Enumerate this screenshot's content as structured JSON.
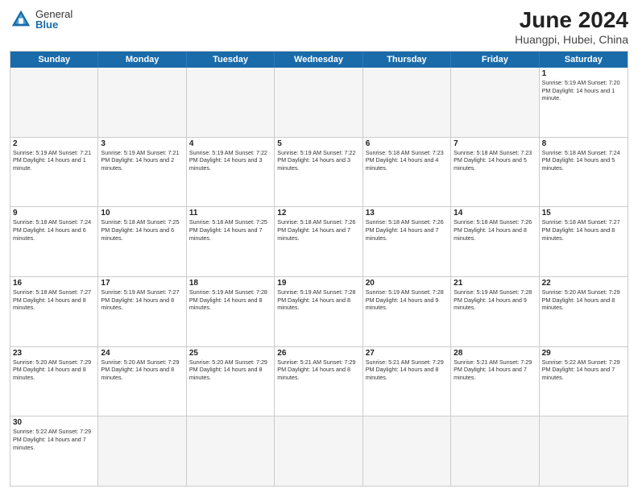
{
  "header": {
    "logo_general": "General",
    "logo_blue": "Blue",
    "title": "June 2024",
    "location": "Huangpi, Hubei, China"
  },
  "weekdays": [
    "Sunday",
    "Monday",
    "Tuesday",
    "Wednesday",
    "Thursday",
    "Friday",
    "Saturday"
  ],
  "rows": [
    [
      {
        "day": "",
        "content": "",
        "empty": true
      },
      {
        "day": "",
        "content": "",
        "empty": true
      },
      {
        "day": "",
        "content": "",
        "empty": true
      },
      {
        "day": "",
        "content": "",
        "empty": true
      },
      {
        "day": "",
        "content": "",
        "empty": true
      },
      {
        "day": "",
        "content": "",
        "empty": true
      },
      {
        "day": "1",
        "content": "Sunrise: 5:19 AM\nSunset: 7:20 PM\nDaylight: 14 hours\nand 1 minute.",
        "empty": false
      }
    ],
    [
      {
        "day": "2",
        "content": "Sunrise: 5:19 AM\nSunset: 7:21 PM\nDaylight: 14 hours\nand 1 minute.",
        "empty": false
      },
      {
        "day": "3",
        "content": "Sunrise: 5:19 AM\nSunset: 7:21 PM\nDaylight: 14 hours\nand 2 minutes.",
        "empty": false
      },
      {
        "day": "4",
        "content": "Sunrise: 5:19 AM\nSunset: 7:22 PM\nDaylight: 14 hours\nand 3 minutes.",
        "empty": false
      },
      {
        "day": "5",
        "content": "Sunrise: 5:19 AM\nSunset: 7:22 PM\nDaylight: 14 hours\nand 3 minutes.",
        "empty": false
      },
      {
        "day": "6",
        "content": "Sunrise: 5:18 AM\nSunset: 7:23 PM\nDaylight: 14 hours\nand 4 minutes.",
        "empty": false
      },
      {
        "day": "7",
        "content": "Sunrise: 5:18 AM\nSunset: 7:23 PM\nDaylight: 14 hours\nand 5 minutes.",
        "empty": false
      },
      {
        "day": "8",
        "content": "Sunrise: 5:18 AM\nSunset: 7:24 PM\nDaylight: 14 hours\nand 5 minutes.",
        "empty": false
      }
    ],
    [
      {
        "day": "9",
        "content": "Sunrise: 5:18 AM\nSunset: 7:24 PM\nDaylight: 14 hours\nand 6 minutes.",
        "empty": false
      },
      {
        "day": "10",
        "content": "Sunrise: 5:18 AM\nSunset: 7:25 PM\nDaylight: 14 hours\nand 6 minutes.",
        "empty": false
      },
      {
        "day": "11",
        "content": "Sunrise: 5:18 AM\nSunset: 7:25 PM\nDaylight: 14 hours\nand 7 minutes.",
        "empty": false
      },
      {
        "day": "12",
        "content": "Sunrise: 5:18 AM\nSunset: 7:26 PM\nDaylight: 14 hours\nand 7 minutes.",
        "empty": false
      },
      {
        "day": "13",
        "content": "Sunrise: 5:18 AM\nSunset: 7:26 PM\nDaylight: 14 hours\nand 7 minutes.",
        "empty": false
      },
      {
        "day": "14",
        "content": "Sunrise: 5:18 AM\nSunset: 7:26 PM\nDaylight: 14 hours\nand 8 minutes.",
        "empty": false
      },
      {
        "day": "15",
        "content": "Sunrise: 5:18 AM\nSunset: 7:27 PM\nDaylight: 14 hours\nand 8 minutes.",
        "empty": false
      }
    ],
    [
      {
        "day": "16",
        "content": "Sunrise: 5:18 AM\nSunset: 7:27 PM\nDaylight: 14 hours\nand 8 minutes.",
        "empty": false
      },
      {
        "day": "17",
        "content": "Sunrise: 5:19 AM\nSunset: 7:27 PM\nDaylight: 14 hours\nand 8 minutes.",
        "empty": false
      },
      {
        "day": "18",
        "content": "Sunrise: 5:19 AM\nSunset: 7:28 PM\nDaylight: 14 hours\nand 8 minutes.",
        "empty": false
      },
      {
        "day": "19",
        "content": "Sunrise: 5:19 AM\nSunset: 7:28 PM\nDaylight: 14 hours\nand 8 minutes.",
        "empty": false
      },
      {
        "day": "20",
        "content": "Sunrise: 5:19 AM\nSunset: 7:28 PM\nDaylight: 14 hours\nand 9 minutes.",
        "empty": false
      },
      {
        "day": "21",
        "content": "Sunrise: 5:19 AM\nSunset: 7:28 PM\nDaylight: 14 hours\nand 9 minutes.",
        "empty": false
      },
      {
        "day": "22",
        "content": "Sunrise: 5:20 AM\nSunset: 7:29 PM\nDaylight: 14 hours\nand 8 minutes.",
        "empty": false
      }
    ],
    [
      {
        "day": "23",
        "content": "Sunrise: 5:20 AM\nSunset: 7:29 PM\nDaylight: 14 hours\nand 8 minutes.",
        "empty": false
      },
      {
        "day": "24",
        "content": "Sunrise: 5:20 AM\nSunset: 7:29 PM\nDaylight: 14 hours\nand 8 minutes.",
        "empty": false
      },
      {
        "day": "25",
        "content": "Sunrise: 5:20 AM\nSunset: 7:29 PM\nDaylight: 14 hours\nand 8 minutes.",
        "empty": false
      },
      {
        "day": "26",
        "content": "Sunrise: 5:21 AM\nSunset: 7:29 PM\nDaylight: 14 hours\nand 8 minutes.",
        "empty": false
      },
      {
        "day": "27",
        "content": "Sunrise: 5:21 AM\nSunset: 7:29 PM\nDaylight: 14 hours\nand 8 minutes.",
        "empty": false
      },
      {
        "day": "28",
        "content": "Sunrise: 5:21 AM\nSunset: 7:29 PM\nDaylight: 14 hours\nand 7 minutes.",
        "empty": false
      },
      {
        "day": "29",
        "content": "Sunrise: 5:22 AM\nSunset: 7:29 PM\nDaylight: 14 hours\nand 7 minutes.",
        "empty": false
      }
    ],
    [
      {
        "day": "30",
        "content": "Sunrise: 5:22 AM\nSunset: 7:29 PM\nDaylight: 14 hours\nand 7 minutes.",
        "empty": false
      },
      {
        "day": "",
        "content": "",
        "empty": true
      },
      {
        "day": "",
        "content": "",
        "empty": true
      },
      {
        "day": "",
        "content": "",
        "empty": true
      },
      {
        "day": "",
        "content": "",
        "empty": true
      },
      {
        "day": "",
        "content": "",
        "empty": true
      },
      {
        "day": "",
        "content": "",
        "empty": true
      }
    ]
  ]
}
